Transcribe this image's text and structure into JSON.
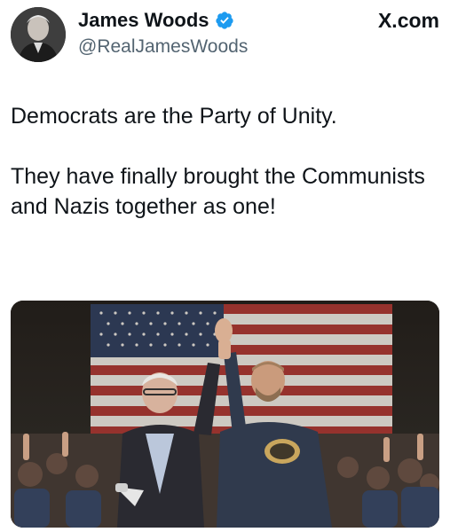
{
  "tweet": {
    "author": {
      "display_name": "James Woods",
      "handle": "@RealJamesWoods",
      "verified": true,
      "avatar_icon": "profile-photo"
    },
    "brand_label": "X.com",
    "text": {
      "line1": "Democrats are the Party of Unity.",
      "line2": "They have finally brought the Communists and Nazis together as one!"
    },
    "media": {
      "kind": "photo"
    }
  },
  "colors": {
    "verified_blue": "#1d9bf0",
    "secondary_text": "#536471",
    "primary_text": "#0f1419"
  }
}
